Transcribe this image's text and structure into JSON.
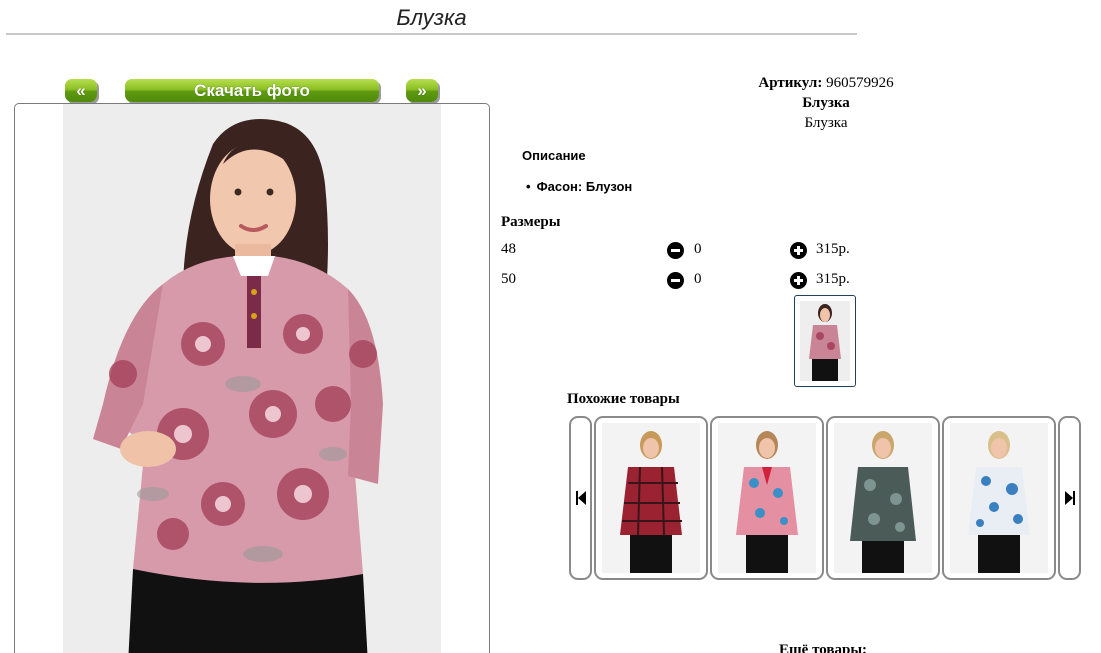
{
  "page": {
    "title": "Блузка"
  },
  "gallery": {
    "prev_label": "«",
    "download_label": "Скачать фото",
    "next_label": "»"
  },
  "product": {
    "article_label": "Артикул:",
    "article_value": "960579926",
    "name": "Блузка",
    "subtitle": "Блузка",
    "description_title": "Описание",
    "description_items": [
      "Фасон: Блузон"
    ]
  },
  "sizes": {
    "title": "Размеры",
    "rows": [
      {
        "size": "48",
        "qty": "0",
        "price": "315р."
      },
      {
        "size": "50",
        "qty": "0",
        "price": "315р."
      }
    ]
  },
  "similar": {
    "title": "Похожие товары"
  },
  "more": {
    "title": "Ещё товары:"
  },
  "colors": {
    "button_green": "#7bb21b",
    "text": "#000000",
    "border": "#8a8a8a"
  }
}
